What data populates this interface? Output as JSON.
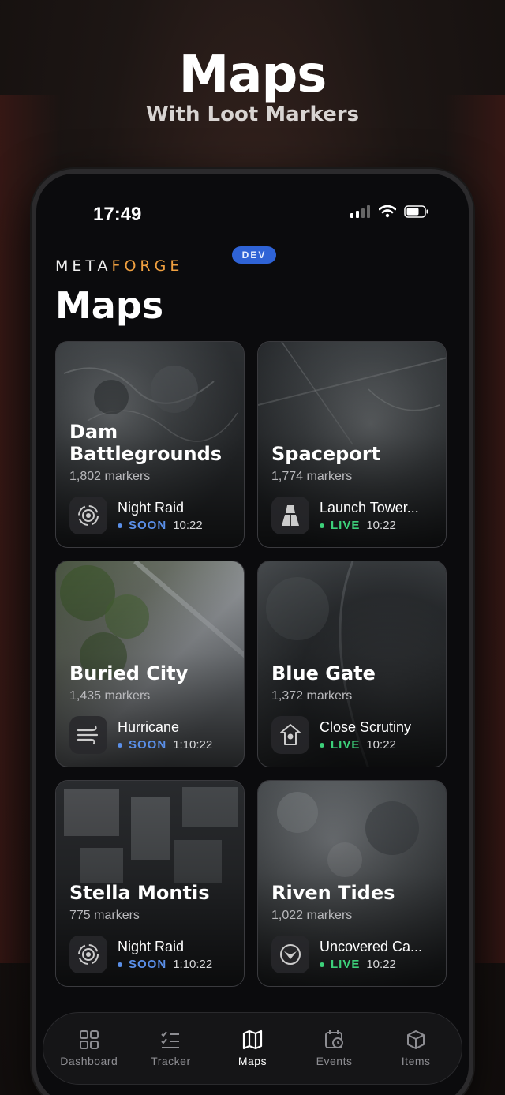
{
  "promo": {
    "title": "Maps",
    "subtitle": "With Loot Markers"
  },
  "status_bar": {
    "time": "17:49",
    "icons": [
      "cellular-icon",
      "wifi-icon",
      "battery-icon"
    ]
  },
  "header": {
    "brand_prefix": "META",
    "brand_suffix": "FORGE",
    "badge": "DEV",
    "title": "Maps"
  },
  "colors": {
    "accent": "#f0a040",
    "badge": "#2f63d6",
    "soon": "#5a8fe8",
    "live": "#3dd07a"
  },
  "maps": [
    {
      "name": "Dam Battlegrounds",
      "markers": "1,802 markers",
      "event": "Night Raid",
      "status": "SOON",
      "timer": "10:22",
      "icon": "night-raid-icon"
    },
    {
      "name": "Spaceport",
      "markers": "1,774 markers",
      "event": "Launch Tower...",
      "status": "LIVE",
      "timer": "10:22",
      "icon": "launch-tower-icon"
    },
    {
      "name": "Buried City",
      "markers": "1,435 markers",
      "event": "Hurricane",
      "status": "SOON",
      "timer": "1:10:22",
      "icon": "hurricane-icon"
    },
    {
      "name": "Blue Gate",
      "markers": "1,372 markers",
      "event": "Close Scrutiny",
      "status": "LIVE",
      "timer": "10:22",
      "icon": "close-scrutiny-icon"
    },
    {
      "name": "Stella Montis",
      "markers": "775 markers",
      "event": "Night Raid",
      "status": "SOON",
      "timer": "1:10:22",
      "icon": "night-raid-icon"
    },
    {
      "name": "Riven Tides",
      "markers": "1,022 markers",
      "event": "Uncovered Ca...",
      "status": "LIVE",
      "timer": "10:22",
      "icon": "uncovered-caches-icon"
    }
  ],
  "tabs": [
    {
      "label": "Dashboard",
      "icon": "dashboard-icon",
      "active": false
    },
    {
      "label": "Tracker",
      "icon": "tracker-icon",
      "active": false
    },
    {
      "label": "Maps",
      "icon": "map-icon",
      "active": true
    },
    {
      "label": "Events",
      "icon": "calendar-icon",
      "active": false
    },
    {
      "label": "Items",
      "icon": "box-icon",
      "active": false
    }
  ]
}
